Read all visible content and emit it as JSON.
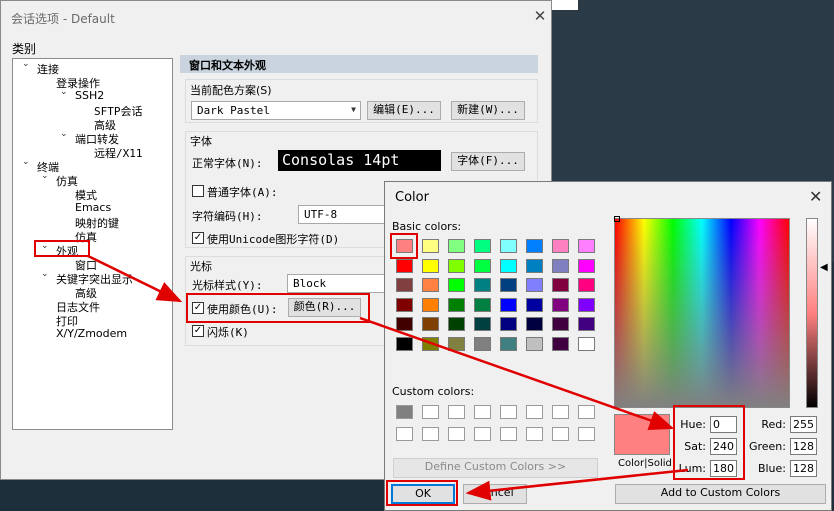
{
  "main_dialog": {
    "title": "会话选项 - Default",
    "close_glyph": "✕",
    "category_label": "类别",
    "tree": [
      {
        "label": "连接",
        "toggle": "⌄"
      },
      {
        "label": "登录操作"
      },
      {
        "label": "SSH2",
        "toggle": "⌄"
      },
      {
        "label": "SFTP会话"
      },
      {
        "label": "高级"
      },
      {
        "label": "端口转发",
        "toggle": "⌄"
      },
      {
        "label": "远程/X11"
      },
      {
        "label": "终端",
        "toggle": "⌄"
      },
      {
        "label": "仿真",
        "toggle": "⌄"
      },
      {
        "label": "模式"
      },
      {
        "label": "Emacs"
      },
      {
        "label": "映射的键"
      },
      {
        "label": "仿真"
      },
      {
        "label": "外观",
        "toggle": "⌄"
      },
      {
        "label": "窗口"
      },
      {
        "label": "关键字突出显示",
        "toggle": "⌄"
      },
      {
        "label": "高级"
      },
      {
        "label": "日志文件"
      },
      {
        "label": "打印"
      },
      {
        "label": "X/Y/Zmodem"
      }
    ],
    "panel": {
      "section_title": "窗口和文本外观",
      "scheme_group": "当前配色方案(S)",
      "scheme_value": "Dark Pastel",
      "edit_button": "编辑(E)...",
      "new_button": "新建(W)...",
      "font_group": "字体",
      "normal_font_label": "正常字体(N):",
      "font_preview": "Consolas 14pt",
      "font_button": "字体(F)...",
      "narrow_font_label": "普通字体(A):",
      "encoding_label": "字符编码(H):",
      "encoding_value": "UTF-8",
      "unicode_label": "使用Unicode图形字符(D)",
      "cursor_group": "光标",
      "cursor_style_label": "光标样式(Y):",
      "cursor_style_value": "Block",
      "use_color_label": "使用颜色(U):",
      "color_button": "颜色(R)...",
      "blink_label": "闪烁(K)"
    }
  },
  "color_dialog": {
    "title": "Color",
    "close_glyph": "✕",
    "basic_colors_label": "Basic colors:",
    "basic_colors": [
      "#ff8080",
      "#ffff80",
      "#80ff80",
      "#00ff80",
      "#80ffff",
      "#0080ff",
      "#ff80c0",
      "#ff80ff",
      "#ff0000",
      "#ffff00",
      "#80ff00",
      "#00ff40",
      "#00ffff",
      "#0080c0",
      "#8080c0",
      "#ff00ff",
      "#804040",
      "#ff8040",
      "#00ff00",
      "#008080",
      "#004080",
      "#8080ff",
      "#800040",
      "#ff0080",
      "#800000",
      "#ff8000",
      "#008000",
      "#008040",
      "#0000ff",
      "#0000a0",
      "#800080",
      "#8000ff",
      "#400000",
      "#804000",
      "#004000",
      "#004040",
      "#000080",
      "#000040",
      "#400040",
      "#400080",
      "#000000",
      "#808000",
      "#808040",
      "#808080",
      "#408080",
      "#c0c0c0",
      "#400040",
      "#ffffff"
    ],
    "custom_colors_label": "Custom colors:",
    "custom_colors": [
      "#808080",
      "#ffffff",
      "#ffffff",
      "#ffffff",
      "#ffffff",
      "#ffffff",
      "#ffffff",
      "#ffffff",
      "#ffffff",
      "#ffffff",
      "#ffffff",
      "#ffffff",
      "#ffffff",
      "#ffffff",
      "#ffffff",
      "#ffffff"
    ],
    "define_custom_button": "Define Custom Colors >>",
    "ok_button": "OK",
    "cancel_button": "Cancel",
    "add_custom_button": "Add to Custom Colors",
    "color_solid_label": "Color|Solid",
    "selected_color": "#ff8080",
    "hue_label": "Hue:",
    "hue_value": "0",
    "sat_label": "Sat:",
    "sat_value": "240",
    "lum_label": "Lum:",
    "lum_value": "180",
    "red_label": "Red:",
    "red_value": "255",
    "green_label": "Green:",
    "green_value": "128",
    "blue_label": "Blue:",
    "blue_value": "128"
  },
  "annotation_color": "#e00000"
}
